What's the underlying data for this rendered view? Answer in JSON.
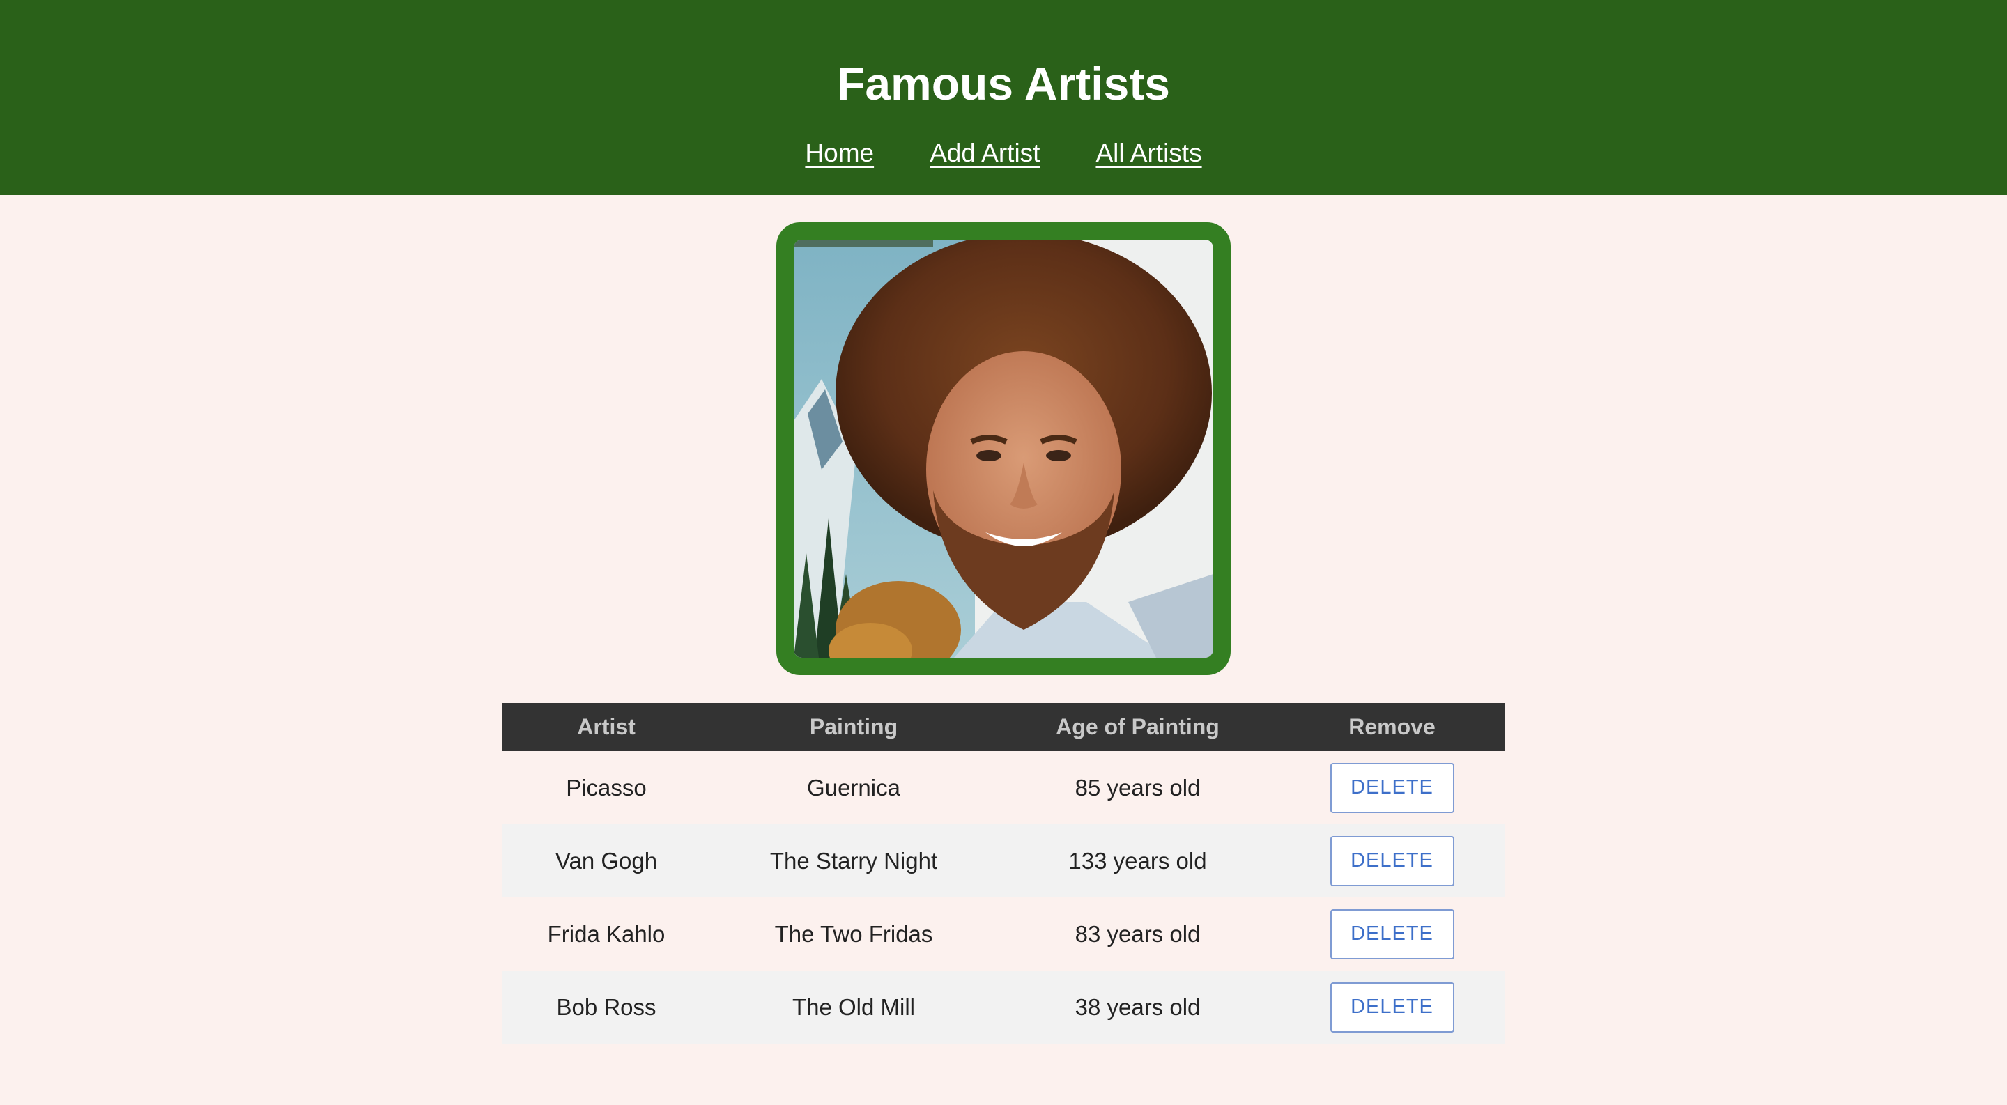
{
  "header": {
    "title": "Famous Artists",
    "nav": [
      {
        "label": "Home"
      },
      {
        "label": "Add Artist"
      },
      {
        "label": "All Artists"
      }
    ],
    "background_color": "#2a6119"
  },
  "featured_image": {
    "alt": "Bob Ross portrait",
    "frame_color": "#347f22"
  },
  "table": {
    "headers": [
      "Artist",
      "Painting",
      "Age of Painting",
      "Remove"
    ],
    "rows": [
      {
        "artist": "Picasso",
        "painting": "Guernica",
        "age": "85 years old",
        "action": "DELETE"
      },
      {
        "artist": "Van Gogh",
        "painting": "The Starry Night",
        "age": "133 years old",
        "action": "DELETE"
      },
      {
        "artist": "Frida Kahlo",
        "painting": "The Two Fridas",
        "age": "83 years old",
        "action": "DELETE"
      },
      {
        "artist": "Bob Ross",
        "painting": "The Old Mill",
        "age": "38 years old",
        "action": "DELETE"
      }
    ]
  },
  "colors": {
    "page_background": "#fcf1ee",
    "table_header": "#333333",
    "delete_button_text": "#3d6fc9"
  }
}
